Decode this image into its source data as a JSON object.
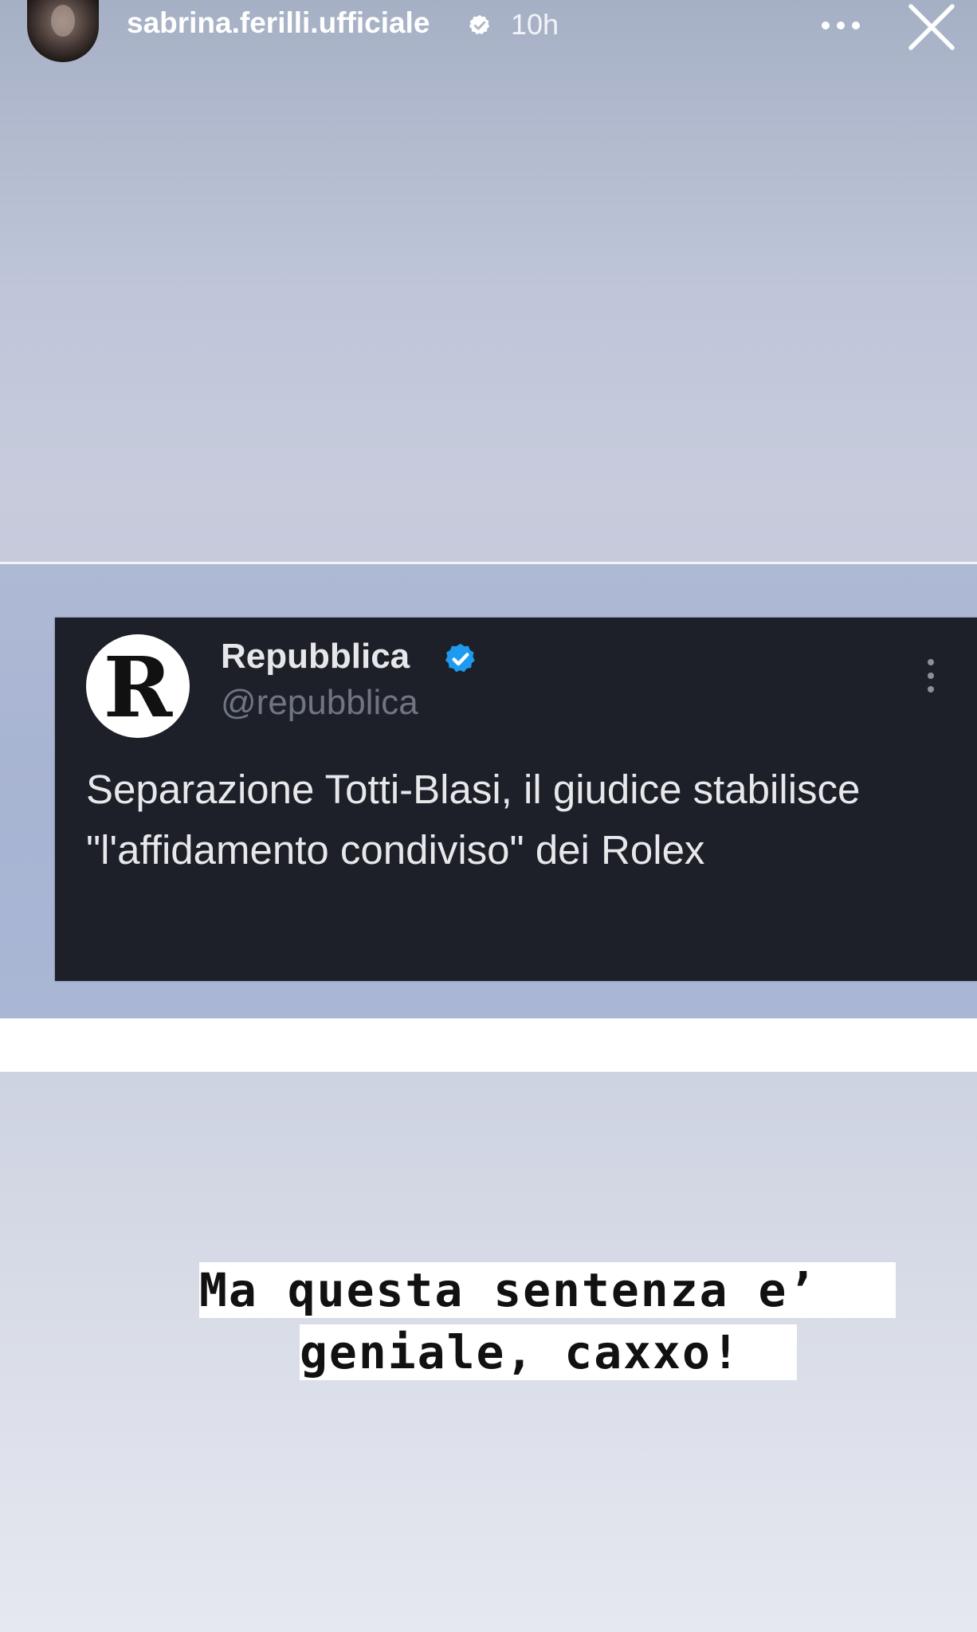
{
  "header": {
    "username": "sabrina.ferilli.ufficiale",
    "time": "10h",
    "icons": {
      "avatar": "profile-avatar",
      "verified": "verified-badge-icon",
      "more": "more-options-icon",
      "close": "close-icon"
    }
  },
  "tweet": {
    "account_name": "Repubblica",
    "handle": "@repubblica",
    "logo_letter": "R",
    "text": "Separazione Totti-Blasi, il giudice stabilisce \"l'affidamento condiviso\" dei Rolex",
    "verified_color": "#1d9bf0"
  },
  "caption": {
    "line1": "Ma questa sentenza e’",
    "line2": "geniale, caxxo!"
  },
  "colors": {
    "tweet_background": "#1d2029",
    "caption_background": "#ffffff"
  }
}
